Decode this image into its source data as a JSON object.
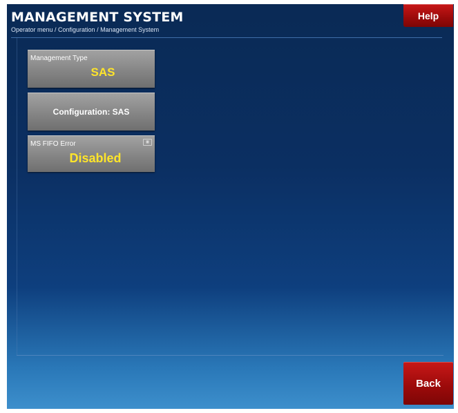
{
  "header": {
    "title": "MANAGEMENT SYSTEM",
    "breadcrumb": "Operator menu / Configuration / Management System",
    "help_label": "Help"
  },
  "tiles": [
    {
      "label": "Management Type",
      "value": "SAS"
    },
    {
      "center_label": "Configuration: SAS"
    },
    {
      "label": "MS FIFO Error",
      "value": "Disabled",
      "icon": "info-icon"
    }
  ],
  "footer": {
    "back_label": "Back"
  },
  "colors": {
    "accent_red": "#b01010",
    "value_yellow": "#ffe52a",
    "background_navy": "#0b2f62"
  }
}
